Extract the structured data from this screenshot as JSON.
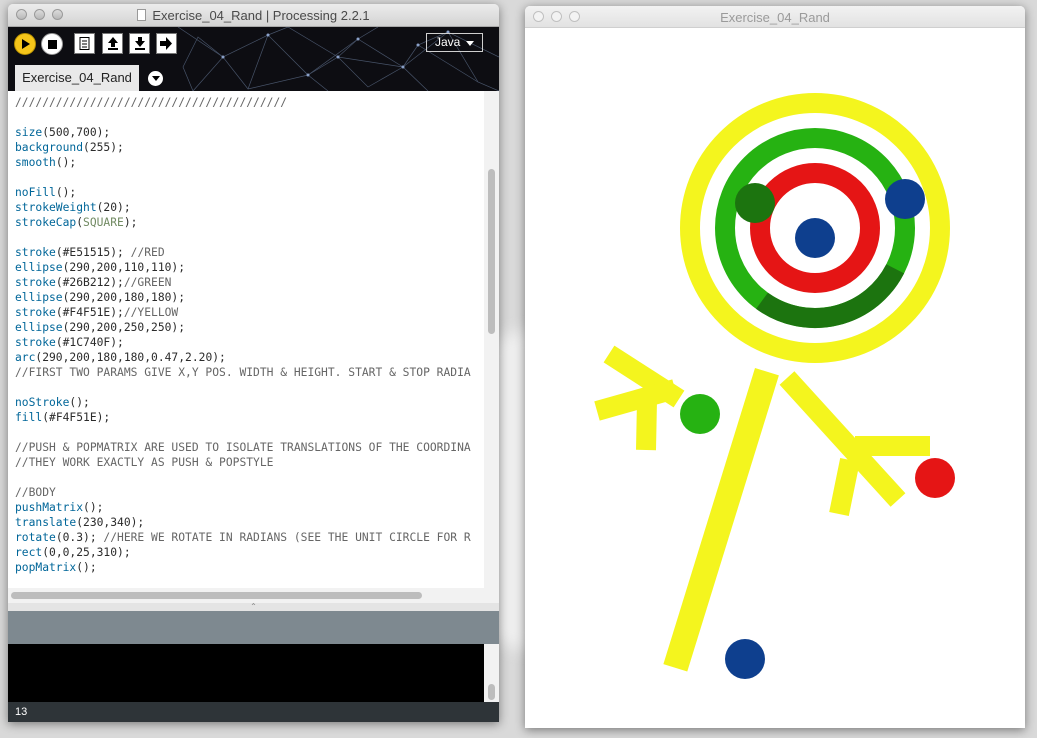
{
  "ide": {
    "title": "Exercise_04_Rand | Processing 2.2.1",
    "mode": "Java",
    "tab": "Exercise_04_Rand",
    "status_line": "13",
    "code_lines": [
      [
        [
          "c",
          "////////////////////////////////////////"
        ]
      ],
      [],
      [
        [
          "f",
          "size"
        ],
        [
          "t",
          "(500,700);"
        ]
      ],
      [
        [
          "f",
          "background"
        ],
        [
          "t",
          "(255);"
        ]
      ],
      [
        [
          "f",
          "smooth"
        ],
        [
          "t",
          "();"
        ]
      ],
      [],
      [
        [
          "f",
          "noFill"
        ],
        [
          "t",
          "();"
        ]
      ],
      [
        [
          "f",
          "strokeWeight"
        ],
        [
          "t",
          "(20);"
        ]
      ],
      [
        [
          "f",
          "strokeCap"
        ],
        [
          "t",
          "("
        ],
        [
          "k",
          "SQUARE"
        ],
        [
          "t",
          ");"
        ]
      ],
      [],
      [
        [
          "f",
          "stroke"
        ],
        [
          "t",
          "(#E51515); "
        ],
        [
          "c",
          "//RED"
        ]
      ],
      [
        [
          "f",
          "ellipse"
        ],
        [
          "t",
          "(290,200,110,110);"
        ]
      ],
      [
        [
          "f",
          "stroke"
        ],
        [
          "t",
          "(#26B212);"
        ],
        [
          "c",
          "//GREEN"
        ]
      ],
      [
        [
          "f",
          "ellipse"
        ],
        [
          "t",
          "(290,200,180,180);"
        ]
      ],
      [
        [
          "f",
          "stroke"
        ],
        [
          "t",
          "(#F4F51E);"
        ],
        [
          "c",
          "//YELLOW"
        ]
      ],
      [
        [
          "f",
          "ellipse"
        ],
        [
          "t",
          "(290,200,250,250);"
        ]
      ],
      [
        [
          "f",
          "stroke"
        ],
        [
          "t",
          "(#1C740F);"
        ]
      ],
      [
        [
          "f",
          "arc"
        ],
        [
          "t",
          "(290,200,180,180,0.47,2.20);"
        ]
      ],
      [
        [
          "c",
          "//FIRST TWO PARAMS GIVE X,Y POS. WIDTH & HEIGHT. START & STOP RADIA"
        ]
      ],
      [],
      [
        [
          "f",
          "noStroke"
        ],
        [
          "t",
          "();"
        ]
      ],
      [
        [
          "f",
          "fill"
        ],
        [
          "t",
          "(#F4F51E);"
        ]
      ],
      [],
      [
        [
          "c",
          "//PUSH & POPMATRIX ARE USED TO ISOLATE TRANSLATIONS OF THE COORDINA"
        ]
      ],
      [
        [
          "c",
          "//THEY WORK EXACTLY AS PUSH & POPSTYLE"
        ]
      ],
      [],
      [
        [
          "c",
          "//BODY"
        ]
      ],
      [
        [
          "f",
          "pushMatrix"
        ],
        [
          "t",
          "();"
        ]
      ],
      [
        [
          "f",
          "translate"
        ],
        [
          "t",
          "(230,340);"
        ]
      ],
      [
        [
          "f",
          "rotate"
        ],
        [
          "t",
          "(0.3); "
        ],
        [
          "c",
          "//HERE WE ROTATE IN RADIANS (SEE THE UNIT CIRCLE FOR R"
        ]
      ],
      [
        [
          "f",
          "rect"
        ],
        [
          "t",
          "(0,0,25,310);"
        ]
      ],
      [
        [
          "f",
          "popMatrix"
        ],
        [
          "t",
          "();"
        ]
      ]
    ]
  },
  "sketch": {
    "title": "Exercise_04_Rand",
    "colors": {
      "red": "#E51515",
      "green": "#26B212",
      "yellow": "#F4F51E",
      "dark_green": "#1C740F",
      "blue": "#0E3F8E",
      "background": "#FFFFFF"
    }
  },
  "icons": {
    "run": "play-icon",
    "stop": "stop-icon",
    "new": "new-file-icon",
    "open": "open-icon",
    "save": "save-icon",
    "export": "export-icon"
  }
}
